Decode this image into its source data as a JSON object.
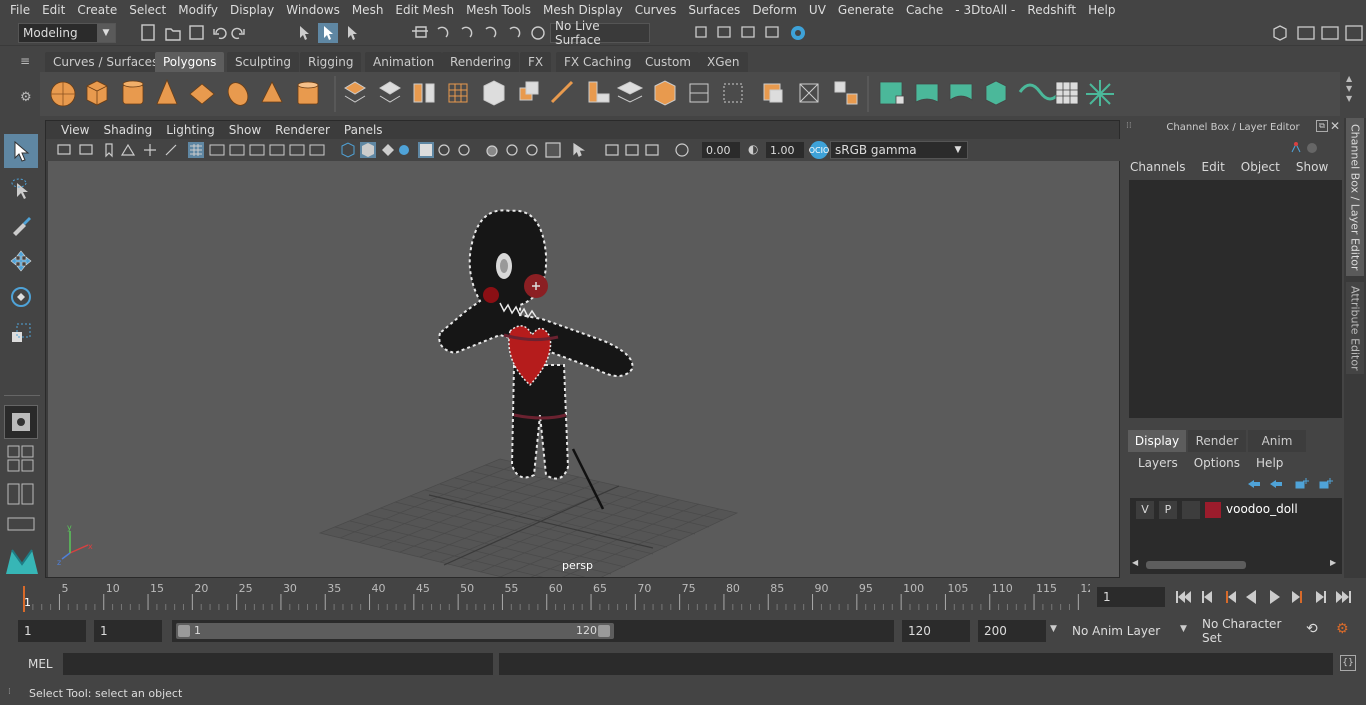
{
  "menubar": {
    "items": [
      "File",
      "Edit",
      "Create",
      "Select",
      "Modify",
      "Display",
      "Windows",
      "Mesh",
      "Edit Mesh",
      "Mesh Tools",
      "Mesh Display",
      "Curves",
      "Surfaces",
      "Deform",
      "UV",
      "Generate",
      "Cache",
      "- 3DtoAll -",
      "Redshift",
      "Help"
    ]
  },
  "statusline": {
    "mode": "Modeling",
    "live_surface": "No Live Surface"
  },
  "shelf": {
    "tabs": [
      "Curves / Surfaces",
      "Polygons",
      "Sculpting",
      "Rigging",
      "Animation",
      "Rendering",
      "FX",
      "FX Caching",
      "Custom",
      "XGen"
    ],
    "active_tab": "Polygons"
  },
  "viewport": {
    "menu": [
      "View",
      "Shading",
      "Lighting",
      "Show",
      "Renderer",
      "Panels"
    ],
    "exposure": "0.00",
    "gamma": "1.00",
    "colorspace": "sRGB gamma",
    "camera_label": "persp"
  },
  "channelbox": {
    "title": "Channel Box / Layer Editor",
    "menu": [
      "Channels",
      "Edit",
      "Object",
      "Show"
    ]
  },
  "layereditor": {
    "tabs": [
      "Display",
      "Render",
      "Anim"
    ],
    "active_tab": "Display",
    "menu": [
      "Layers",
      "Options",
      "Help"
    ],
    "layer": {
      "v": "V",
      "p": "P",
      "name": "voodoo_doll",
      "color": "#9b1c2c"
    }
  },
  "sidetabs": {
    "channel": "Channel Box / Layer Editor",
    "attribute": "Attribute Editor"
  },
  "timeline": {
    "labels": [
      "5",
      "10",
      "15",
      "20",
      "25",
      "30",
      "35",
      "40",
      "45",
      "50",
      "55",
      "60",
      "65",
      "70",
      "75",
      "80",
      "85",
      "90",
      "95",
      "100",
      "105",
      "110",
      "115",
      "12"
    ],
    "first_label": "1",
    "current_frame": "1"
  },
  "range": {
    "start": "1",
    "playback_start": "1",
    "slider_start": "1",
    "slider_end": "120",
    "playback_end": "120",
    "end": "200",
    "anim_layer": "No Anim Layer",
    "char_set": "No Character Set"
  },
  "cmdline": {
    "lang": "MEL"
  },
  "helpline": {
    "text": "Select Tool: select an object"
  }
}
